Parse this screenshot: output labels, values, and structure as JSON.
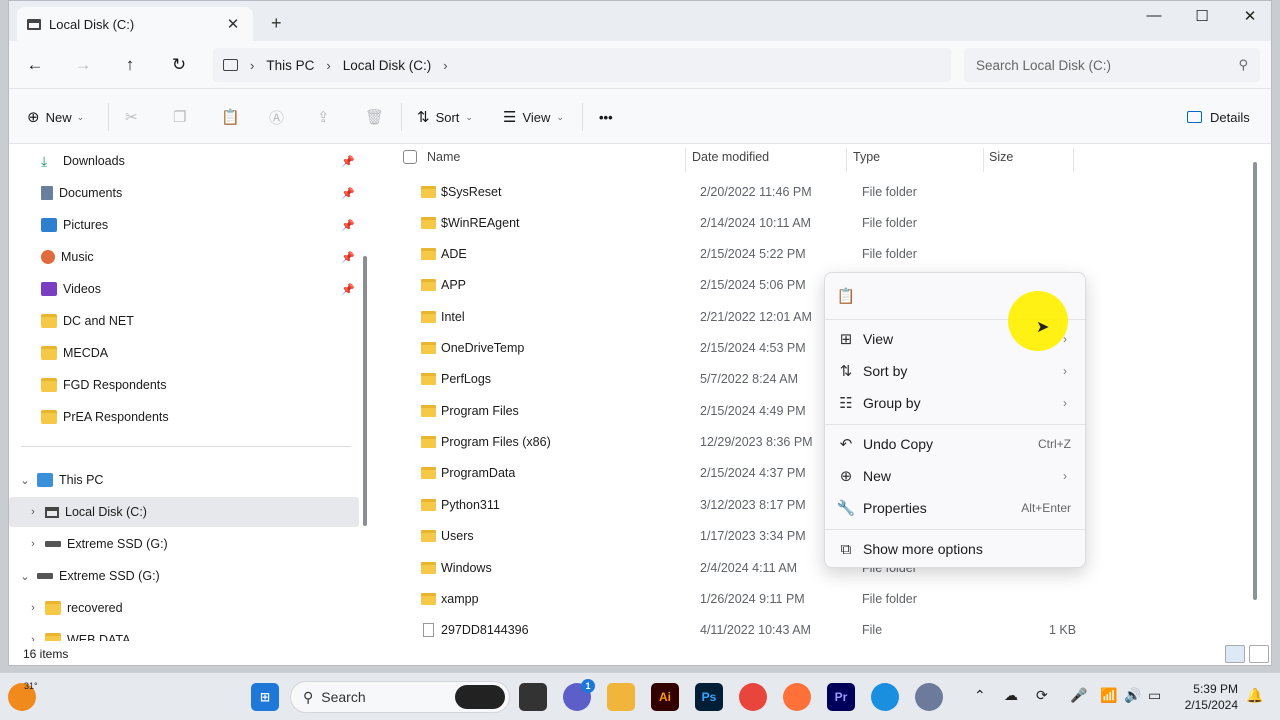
{
  "window": {
    "tab_title": "Local Disk (C:)",
    "close_tab": "✕",
    "new_tab": "+",
    "minimize": "—",
    "maximize": "☐",
    "close": "✕"
  },
  "address": {
    "back": "←",
    "forward": "→",
    "up": "↑",
    "refresh": "↻",
    "breadcrumbs": [
      "This PC",
      "Local Disk (C:)"
    ],
    "search_placeholder": "Search Local Disk (C:)"
  },
  "toolbar": {
    "new_label": "New",
    "sort_label": "Sort",
    "view_label": "View",
    "more_label": "•••",
    "details_label": "Details"
  },
  "sidebar": {
    "quick": [
      {
        "label": "Downloads",
        "icon": "download-icon",
        "pinned": true
      },
      {
        "label": "Documents",
        "icon": "documents-icon",
        "pinned": true
      },
      {
        "label": "Pictures",
        "icon": "pictures-icon",
        "pinned": true
      },
      {
        "label": "Music",
        "icon": "music-icon",
        "pinned": true
      },
      {
        "label": "Videos",
        "icon": "videos-icon",
        "pinned": true
      },
      {
        "label": "DC and NET",
        "icon": "folder-icon"
      },
      {
        "label": "MECDA",
        "icon": "folder-icon"
      },
      {
        "label": "FGD Respondents",
        "icon": "folder-icon"
      },
      {
        "label": "PrEA Respondents",
        "icon": "folder-icon"
      }
    ],
    "tree": [
      {
        "label": "This PC",
        "expanded": true
      },
      {
        "label": "Local Disk (C:)",
        "selected": true
      },
      {
        "label": "Extreme SSD (G:)"
      },
      {
        "label": "Extreme SSD (G:)",
        "expanded": true
      },
      {
        "label": "recovered"
      },
      {
        "label": "WEB DATA"
      }
    ]
  },
  "columns": {
    "name": "Name",
    "date": "Date modified",
    "type": "Type",
    "size": "Size"
  },
  "files": [
    {
      "name": "$SysReset",
      "date": "2/20/2022 11:46 PM",
      "type": "File folder",
      "size": ""
    },
    {
      "name": "$WinREAgent",
      "date": "2/14/2024 10:11 AM",
      "type": "File folder",
      "size": ""
    },
    {
      "name": "ADE",
      "date": "2/15/2024 5:22 PM",
      "type": "File folder",
      "size": ""
    },
    {
      "name": "APP",
      "date": "2/15/2024 5:06 PM",
      "type": "",
      "size": ""
    },
    {
      "name": "Intel",
      "date": "2/21/2022 12:01 AM",
      "type": "",
      "size": ""
    },
    {
      "name": "OneDriveTemp",
      "date": "2/15/2024 4:53 PM",
      "type": "",
      "size": ""
    },
    {
      "name": "PerfLogs",
      "date": "5/7/2022 8:24 AM",
      "type": "",
      "size": ""
    },
    {
      "name": "Program Files",
      "date": "2/15/2024 4:49 PM",
      "type": "",
      "size": ""
    },
    {
      "name": "Program Files (x86)",
      "date": "12/29/2023 8:36 PM",
      "type": "",
      "size": ""
    },
    {
      "name": "ProgramData",
      "date": "2/15/2024 4:37 PM",
      "type": "",
      "size": ""
    },
    {
      "name": "Python311",
      "date": "3/12/2023 8:17 PM",
      "type": "",
      "size": ""
    },
    {
      "name": "Users",
      "date": "1/17/2023 3:34 PM",
      "type": "",
      "size": ""
    },
    {
      "name": "Windows",
      "date": "2/4/2024 4:11 AM",
      "type": "File folder",
      "size": ""
    },
    {
      "name": "xampp",
      "date": "1/26/2024 9:11 PM",
      "type": "File folder",
      "size": ""
    },
    {
      "name": "297DD8144396",
      "date": "4/11/2022 10:43 AM",
      "type": "File",
      "size": "1 KB"
    }
  ],
  "context_menu": {
    "items": [
      {
        "label": "View",
        "shortcut": "",
        "arrow": "›"
      },
      {
        "label": "Sort by",
        "shortcut": "",
        "arrow": "›"
      },
      {
        "label": "Group by",
        "shortcut": "",
        "arrow": "›"
      },
      {
        "label": "Undo Copy",
        "shortcut": "Ctrl+Z",
        "arrow": ""
      },
      {
        "label": "New",
        "shortcut": "",
        "arrow": "›"
      },
      {
        "label": "Properties",
        "shortcut": "Alt+Enter",
        "arrow": ""
      },
      {
        "label": "Show more options",
        "shortcut": "",
        "arrow": ""
      }
    ]
  },
  "status": {
    "count": "16 items"
  },
  "taskbar": {
    "weather_temp": "31°",
    "search_label": "Search",
    "chat_badge": "1",
    "ai_label": "Ai",
    "ps_label": "Ps",
    "pr_label": "Pr",
    "time": "5:39 PM",
    "date": "2/15/2024"
  },
  "colors": {
    "accent": "#0067c0",
    "folder": "#f6c847",
    "highlight": "#fff000"
  }
}
